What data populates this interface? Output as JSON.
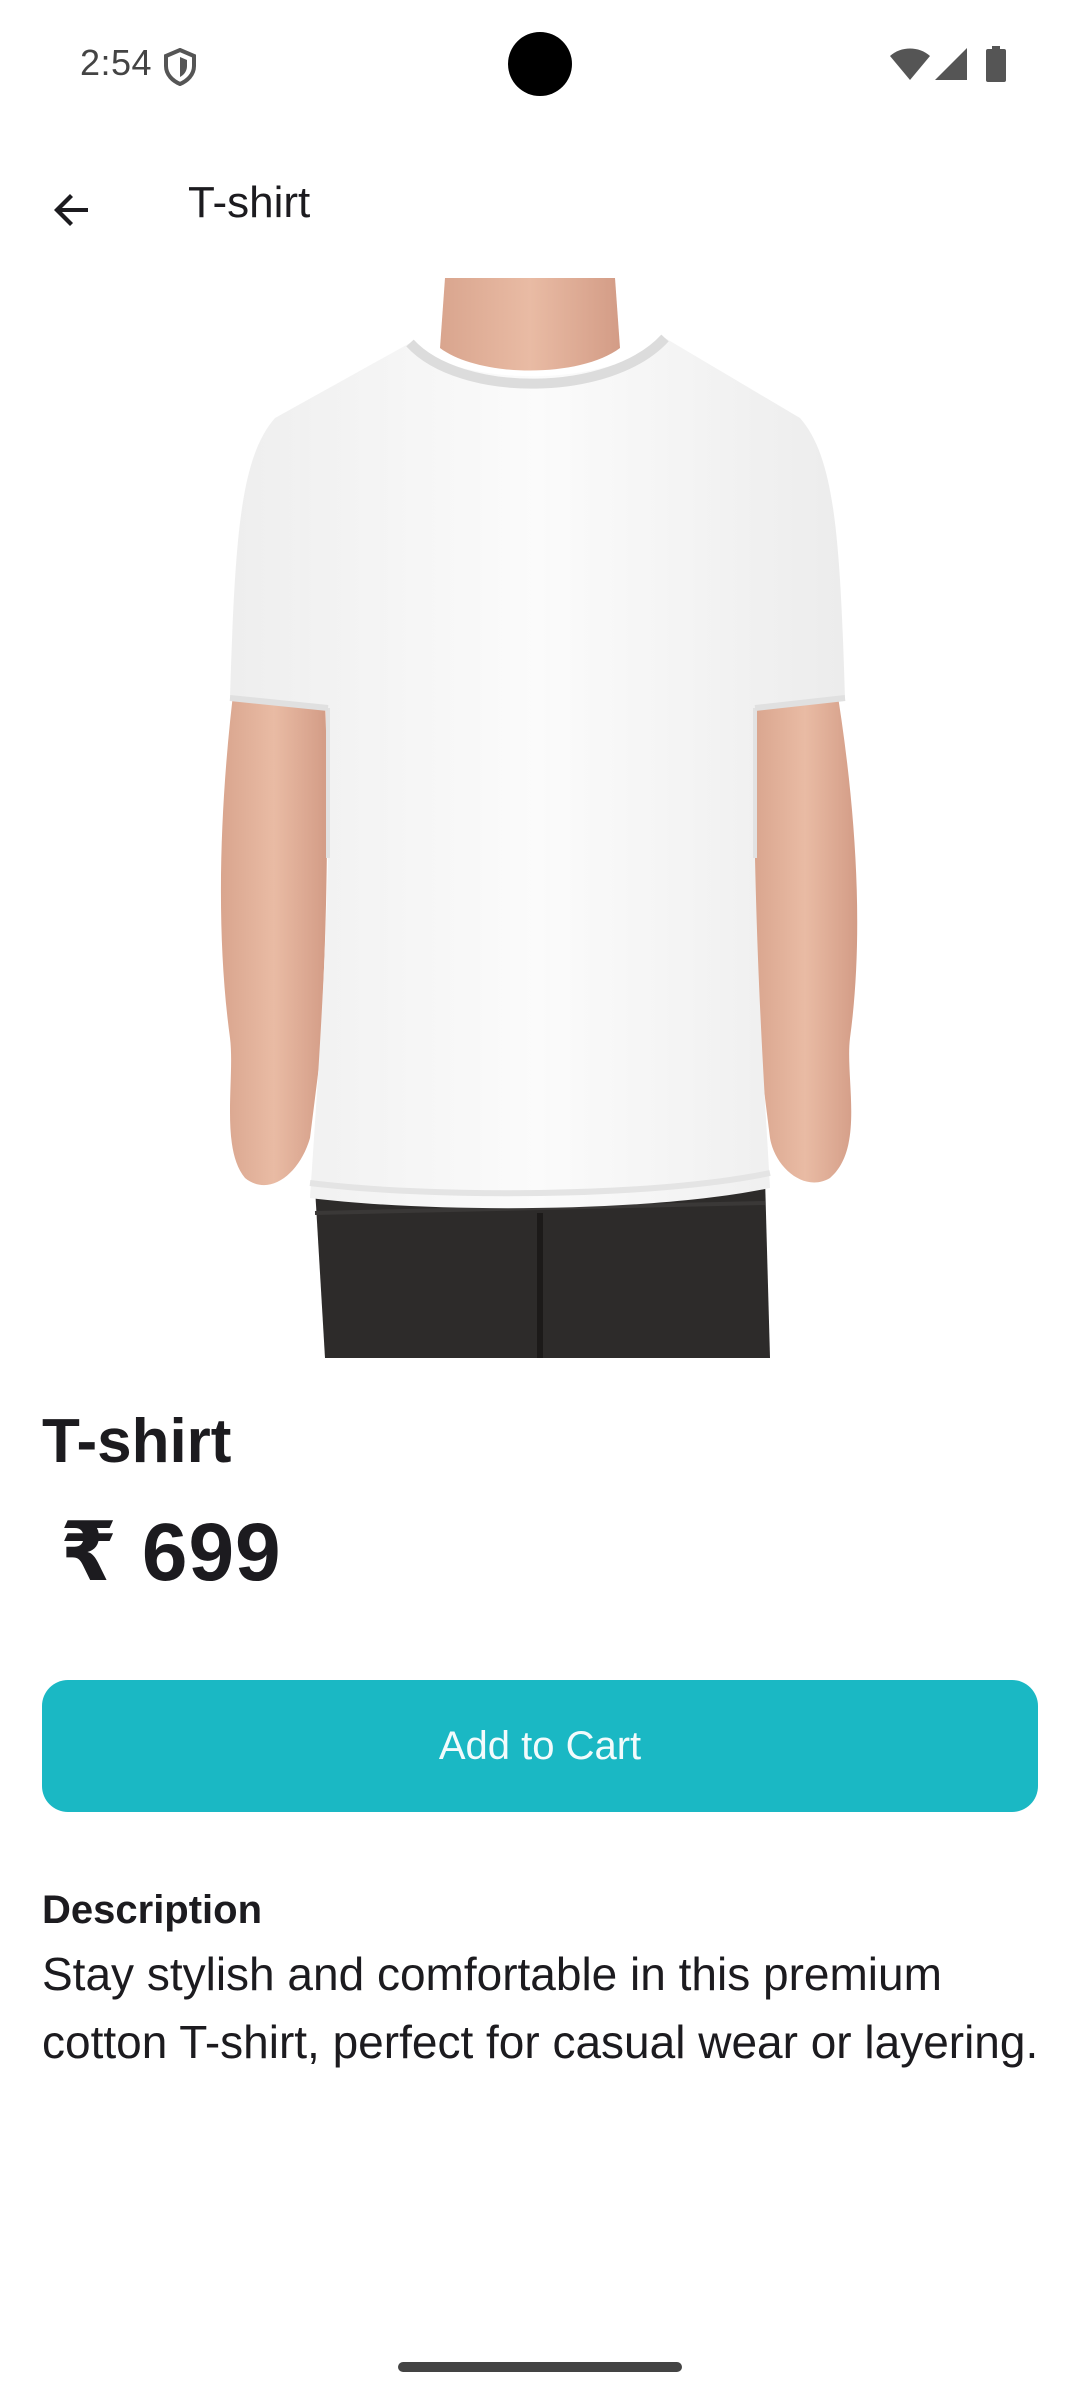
{
  "status_bar": {
    "time": "2:54",
    "icons": [
      "shield-icon",
      "wifi-icon",
      "signal-icon",
      "battery-icon"
    ]
  },
  "app_bar": {
    "back_icon": "arrow-back-icon",
    "title": "T-shirt"
  },
  "product": {
    "image": "white-tshirt-model-photo",
    "name": "T-shirt",
    "price": "₹ 699",
    "add_to_cart_label": "Add to Cart",
    "description_title": "Description",
    "description": "Stay stylish and comfortable in this premium cotton T-shirt, perfect for casual wear or layering."
  },
  "colors": {
    "accent": "#1ab8c4",
    "text": "#1c1b1f",
    "background": "#ffffff"
  }
}
